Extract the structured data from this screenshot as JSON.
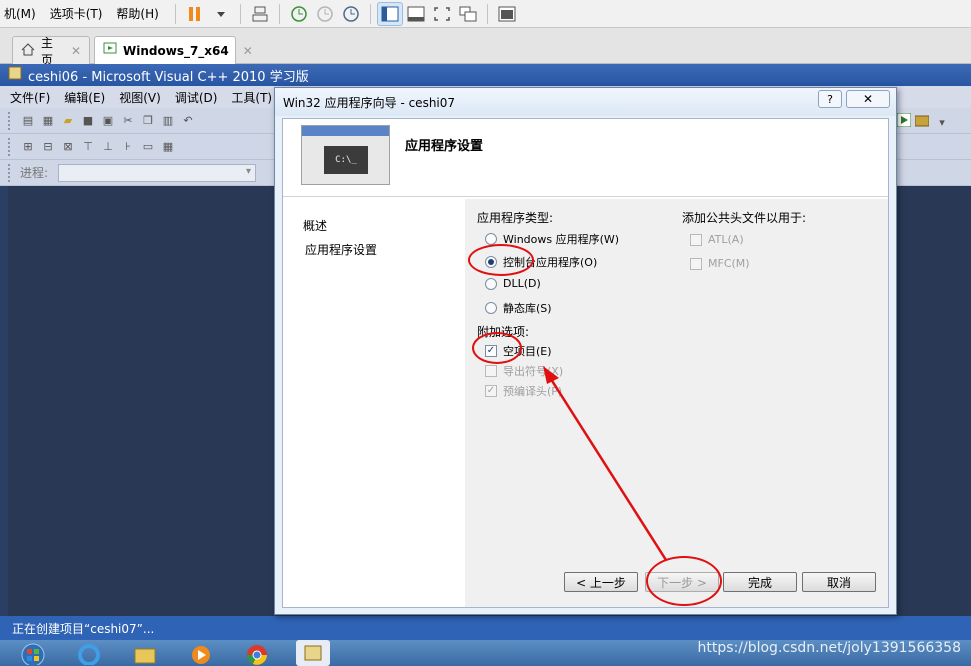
{
  "vmware": {
    "menu": [
      "机(M)",
      "选项卡(T)",
      "帮助(H)"
    ],
    "tabs": [
      {
        "label": "主页"
      },
      {
        "label": "Windows_7_x64"
      }
    ]
  },
  "vs": {
    "title": "ceshi06 - Microsoft Visual C++ 2010 学习版",
    "menu": [
      "文件(F)",
      "编辑(E)",
      "视图(V)",
      "调试(D)",
      "工具(T)"
    ],
    "progress_label": "进程:",
    "status": "正在创建项目“ceshi07”..."
  },
  "wizard": {
    "title": "Win32 应用程序向导 - ceshi07",
    "help_label": "?",
    "header_title": "应用程序设置",
    "header_image_text": "C:\\_",
    "nav": [
      "概述",
      "应用程序设置"
    ],
    "app_type_label": "应用程序类型:",
    "app_types": [
      {
        "label": "Windows 应用程序(W)",
        "checked": false
      },
      {
        "label": "控制台应用程序(O)",
        "checked": true
      },
      {
        "label": "DLL(D)",
        "checked": false
      },
      {
        "label": "静态库(S)",
        "checked": false
      }
    ],
    "extra_label": "附加选项:",
    "extras": [
      {
        "label": "空项目(E)",
        "checked": true,
        "disabled": false
      },
      {
        "label": "导出符号(X)",
        "checked": false,
        "disabled": true
      },
      {
        "label": "预编译头(P)",
        "checked": true,
        "disabled": true
      }
    ],
    "headers_label": "添加公共头文件以用于:",
    "headers": [
      {
        "label": "ATL(A)",
        "disabled": true
      },
      {
        "label": "MFC(M)",
        "disabled": true
      }
    ],
    "buttons": {
      "prev": "< 上一步",
      "next": "下一步 >",
      "finish": "完成",
      "cancel": "取消"
    }
  },
  "watermark": "https://blog.csdn.net/joly1391566358",
  "colors": {
    "annotation": "#e01010",
    "vs_background": "#293955",
    "vs_status": "#2e63b5"
  }
}
